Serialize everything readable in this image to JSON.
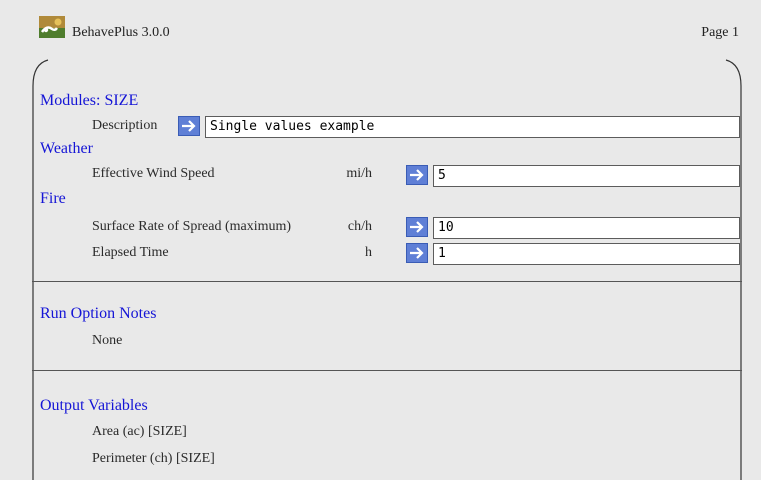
{
  "header": {
    "app_title": "BehavePlus 3.0.0",
    "page_label": "Page 1"
  },
  "modules": {
    "heading": "Modules: SIZE",
    "description_label": "Description",
    "description_value": "Single values example"
  },
  "weather": {
    "heading": "Weather",
    "rows": [
      {
        "label": "Effective Wind Speed",
        "unit": "mi/h",
        "value": "5"
      }
    ]
  },
  "fire": {
    "heading": "Fire",
    "rows": [
      {
        "label": "Surface Rate of Spread (maximum)",
        "unit": "ch/h",
        "value": "10"
      },
      {
        "label": "Elapsed Time",
        "unit": "h",
        "value": "1"
      }
    ]
  },
  "run_options": {
    "heading": "Run Option Notes",
    "note": "None"
  },
  "outputs": {
    "heading": "Output Variables",
    "items": [
      "Area (ac) [SIZE]",
      "Perimeter (ch) [SIZE]"
    ]
  },
  "colors": {
    "heading_blue": "#1515d6",
    "button_blue": "#5f7fd6",
    "background": "#e9e9e9"
  },
  "icons": {
    "app": "behaveplus-app-icon",
    "input_button": "arrow-right-icon"
  }
}
